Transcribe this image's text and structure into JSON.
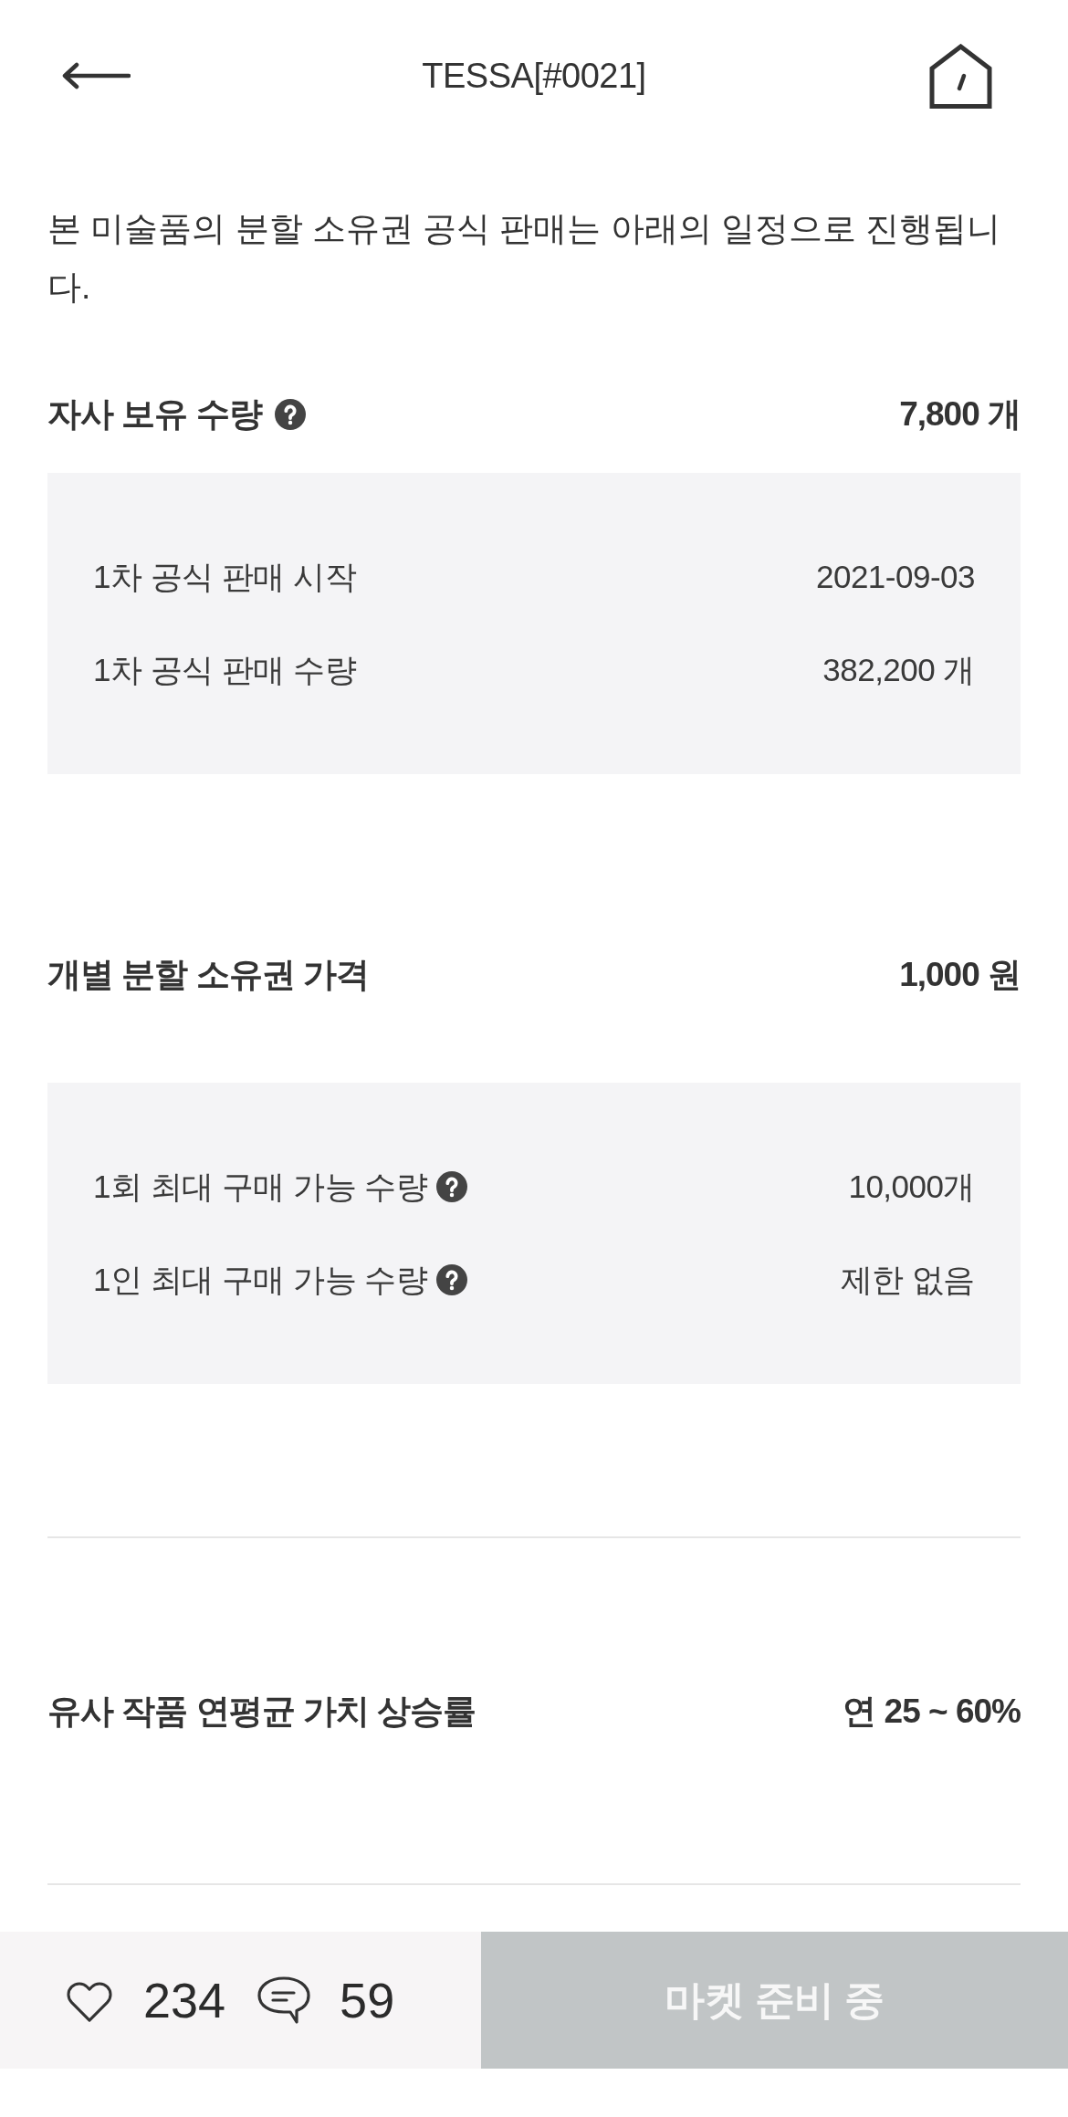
{
  "header": {
    "title": "TESSA[#0021]"
  },
  "intro": "본 미술품의 분할 소유권 공식 판매는 아래의 일정으로 진행됩니다.",
  "sections": [
    {
      "kind": "boxed",
      "label": "자사 보유 수량",
      "help": true,
      "value": "7,800 개",
      "details": [
        {
          "label": "1차 공식 판매 시작",
          "help": false,
          "value": "2021-09-03"
        },
        {
          "label": "1차 공식 판매 수량",
          "help": false,
          "value": "382,200 개"
        }
      ]
    },
    {
      "kind": "boxed",
      "label": "개별 분할 소유권 가격",
      "help": false,
      "value": "1,000 원",
      "details": [
        {
          "label": "1회 최대 구매 가능 수량",
          "help": true,
          "value": "10,000개"
        },
        {
          "label": "1인 최대 구매 가능 수량",
          "help": true,
          "value": "제한 없음"
        }
      ]
    },
    {
      "kind": "ruled",
      "label": "유사 작품 연평균 가치 상승률",
      "help": false,
      "value": "연 25 ~ 60%"
    }
  ],
  "footer": {
    "likes": "234",
    "comments": "59",
    "action": {
      "label": "마켓 준비 중",
      "disabled": true
    }
  }
}
